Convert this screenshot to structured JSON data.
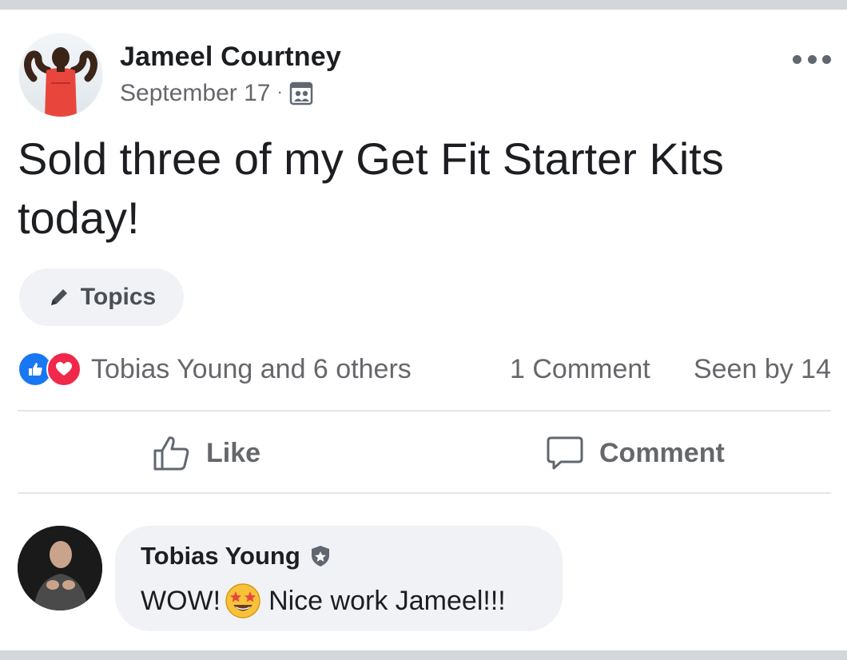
{
  "post": {
    "author": "Jameel Courtney",
    "date": "September 17",
    "separator": "·",
    "audience_icon": "group-audience-icon",
    "more_icon": "more-options-icon",
    "text": "Sold three of my Get Fit Starter Kits today!",
    "topics_label": "Topics",
    "topics_icon": "pencil-icon"
  },
  "engagement": {
    "reaction_icons": [
      "like-reaction-icon",
      "love-reaction-icon"
    ],
    "reactors": "Tobias Young and 6 others",
    "comments": "1 Comment",
    "seen": "Seen by 14"
  },
  "actions": {
    "like_label": "Like",
    "comment_label": "Comment"
  },
  "comment": {
    "author": "Tobias Young",
    "badge_icon": "admin-badge-icon",
    "text_before": "WOW!",
    "emoji": "star-struck-emoji-icon",
    "text_after": " Nice work Jameel!!!"
  },
  "colors": {
    "accent_like": "#1877f2",
    "accent_love": "#f0284a",
    "secondary_text": "#65676b",
    "bubble_bg": "#f0f2f5"
  }
}
